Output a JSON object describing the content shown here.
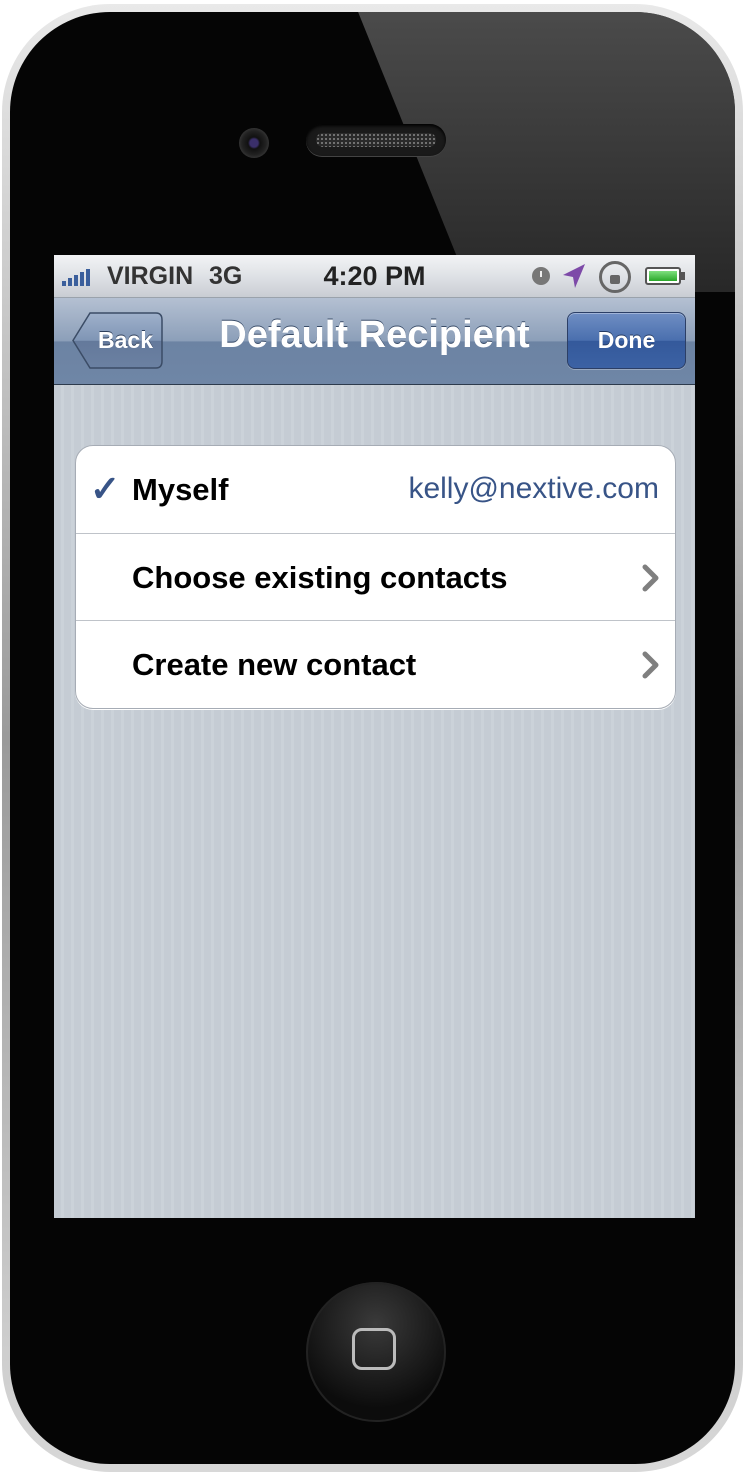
{
  "status_bar": {
    "carrier": "VIRGIN",
    "network": "3G",
    "time": "4:20 PM",
    "battery_level": 1.0
  },
  "nav_bar": {
    "back_label": "Back",
    "title": "Default Recipient",
    "done_label": "Done"
  },
  "options": [
    {
      "label": "Myself",
      "detail": "kelly@nextive.com",
      "checked": true
    },
    {
      "label": "Choose existing contacts",
      "accessory": "chevron-right-icon"
    },
    {
      "label": "Create new contact",
      "accessory": "chevron-right-icon"
    }
  ],
  "colors": {
    "accent_blue": "#385487",
    "table_background": "#c5ccd4",
    "nav_bar": "#6f86a6",
    "done_button": "#3c62a4"
  }
}
